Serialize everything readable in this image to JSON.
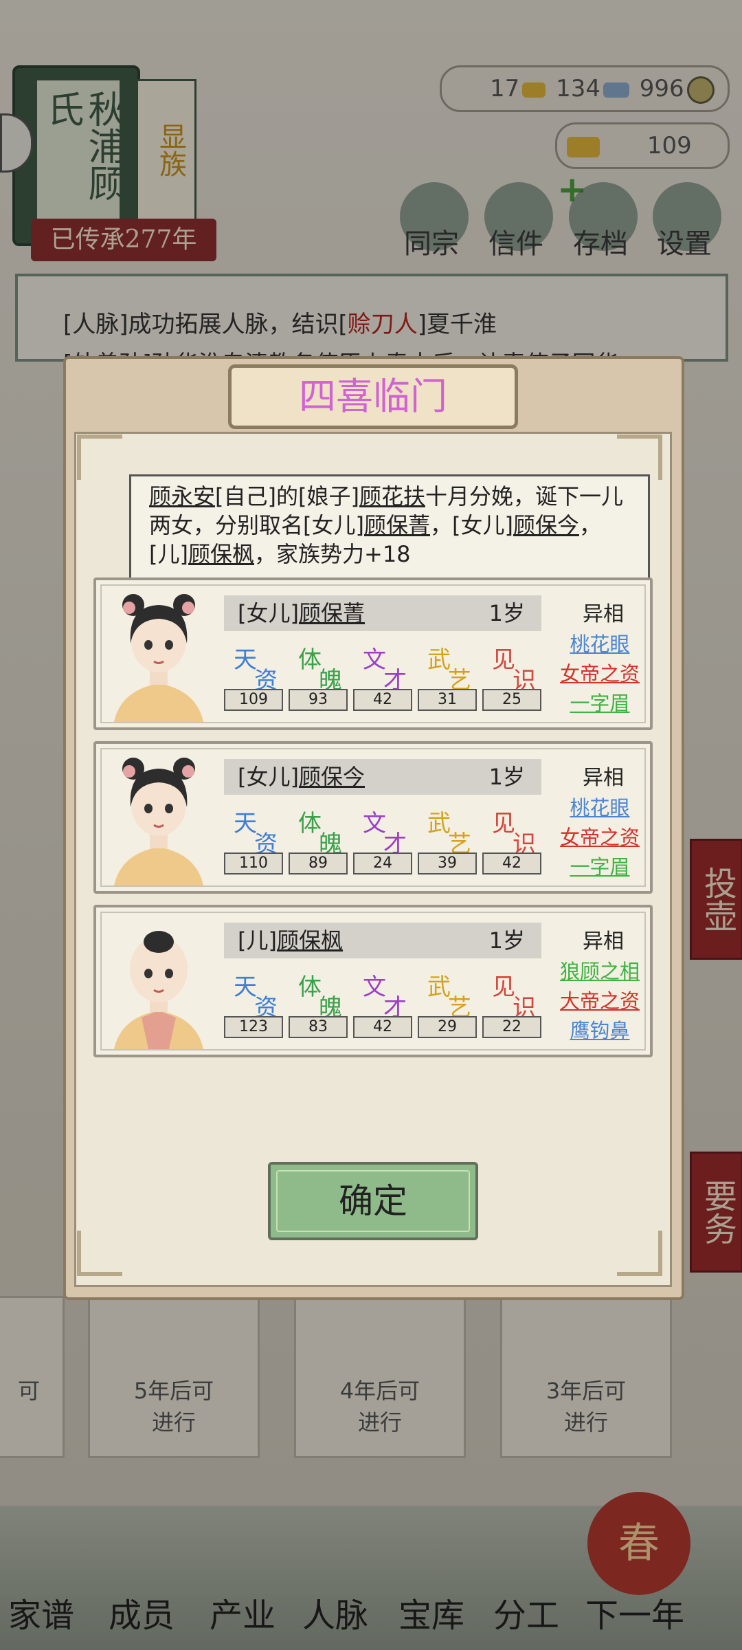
{
  "header": {
    "book_title": "秋浦顾氏",
    "book_tag": "显族",
    "inheritance": "已传承277年",
    "resources": {
      "gold": "17",
      "silver": "134",
      "coins": "996"
    },
    "ingots": "109"
  },
  "top_menu": [
    "同宗",
    "信件",
    "存档",
    "设置"
  ],
  "log": {
    "line1_a": "[人脉]成功拓展人脉，结识[",
    "line1_b": "赊刀人",
    "line1_c": "]夏千淮",
    "line2": "[外曾孙]孙华淮专清教务使臣上奏大后，让毒使子网华"
  },
  "side_buttons": [
    "投壶",
    "要务"
  ],
  "bottom_cards": [
    {
      "line1": "可",
      "line2": ""
    },
    {
      "line1": "5年后可",
      "line2": "进行"
    },
    {
      "line1": "4年后可",
      "line2": "进行"
    },
    {
      "line1": "3年后可",
      "line2": "进行"
    }
  ],
  "bottom_nav": [
    "家谱",
    "成员",
    "产业",
    "人脉",
    "宝库",
    "分工",
    "下一年"
  ],
  "new_year_badge": "春",
  "dialog": {
    "title": "四喜临门",
    "message": {
      "p1": "顾永安",
      "p2": "[自己]的[娘子]",
      "p3": "顾花扶",
      "p4": "十月分娩，诞下一儿两女，分别取名[女儿]",
      "p5": "顾保菁",
      "p6": "，[女儿]",
      "p7": "顾保今",
      "p8": "，[儿]",
      "p9": "顾保枫",
      "p10": "，家族势力+18"
    },
    "stat_labels": [
      {
        "a": "天",
        "b": "资",
        "color": "#3d7fd6"
      },
      {
        "a": "体",
        "b": "魄",
        "color": "#3aa14b"
      },
      {
        "a": "文",
        "b": "才",
        "color": "#9a3fc6"
      },
      {
        "a": "武",
        "b": "艺",
        "color": "#d4a21c"
      },
      {
        "a": "见",
        "b": "识",
        "color": "#d2473f"
      }
    ],
    "trait_header": "异相",
    "children": [
      {
        "relation": "[女儿]",
        "name": "顾保菁",
        "age": "1岁",
        "stats": [
          "109",
          "93",
          "42",
          "31",
          "25"
        ],
        "traits": [
          {
            "text": "桃花眼",
            "color": "#4a86d2"
          },
          {
            "text": "女帝之资",
            "color": "#d2322a"
          },
          {
            "text": "一字眉",
            "color": "#3fb244"
          }
        ]
      },
      {
        "relation": "[女儿]",
        "name": "顾保今",
        "age": "1岁",
        "stats": [
          "110",
          "89",
          "24",
          "39",
          "42"
        ],
        "traits": [
          {
            "text": "桃花眼",
            "color": "#4a86d2"
          },
          {
            "text": "女帝之资",
            "color": "#d2322a"
          },
          {
            "text": "一字眉",
            "color": "#3fb244"
          }
        ]
      },
      {
        "relation": "[儿]",
        "name": "顾保枫",
        "age": "1岁",
        "stats": [
          "123",
          "83",
          "42",
          "29",
          "22"
        ],
        "traits": [
          {
            "text": "狼顾之相",
            "color": "#3fb244"
          },
          {
            "text": "大帝之资",
            "color": "#d2322a"
          },
          {
            "text": "鹰钩鼻",
            "color": "#4a86d2"
          }
        ]
      }
    ],
    "confirm": "确定"
  }
}
